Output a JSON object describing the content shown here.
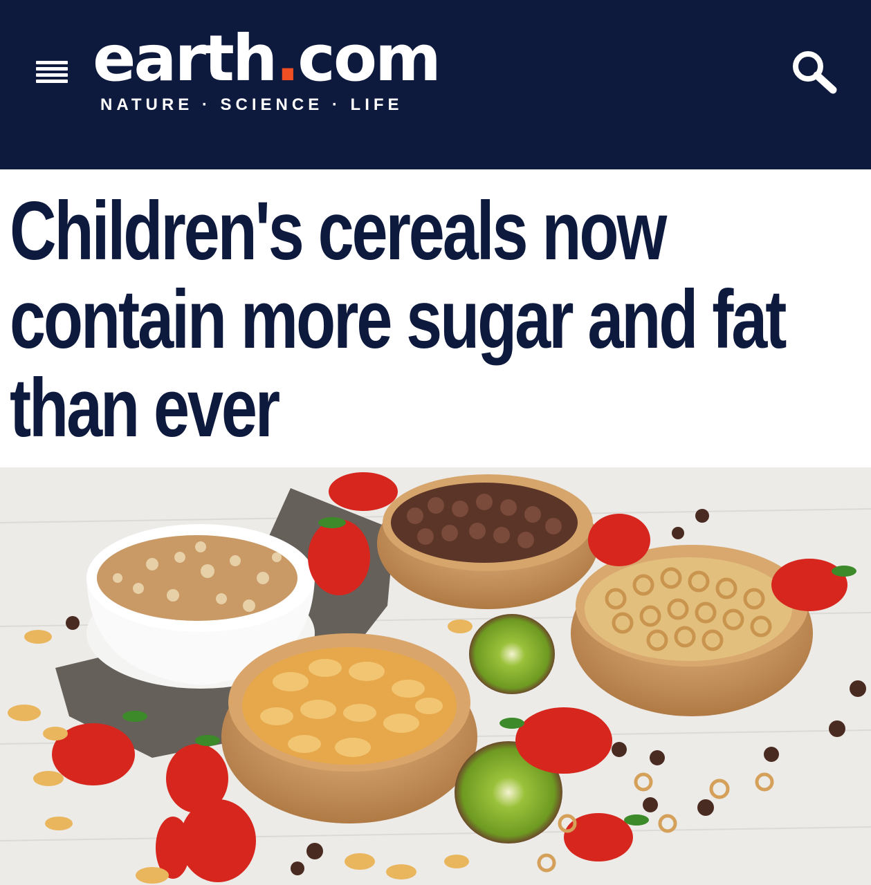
{
  "header": {
    "logo_main": "earth",
    "logo_dot": ".",
    "logo_tld": "com",
    "tagline": "NATURE · SCIENCE · LIFE",
    "menu_icon": "hamburger-menu-icon",
    "search_icon": "search-icon",
    "background_color": "#0e1a3d",
    "accent_color": "#f04e23"
  },
  "article": {
    "headline": "Children's cereals now contain more sugar and fat than ever",
    "image_subject": "bowls of breakfast cereals with strawberries and kiwi"
  }
}
